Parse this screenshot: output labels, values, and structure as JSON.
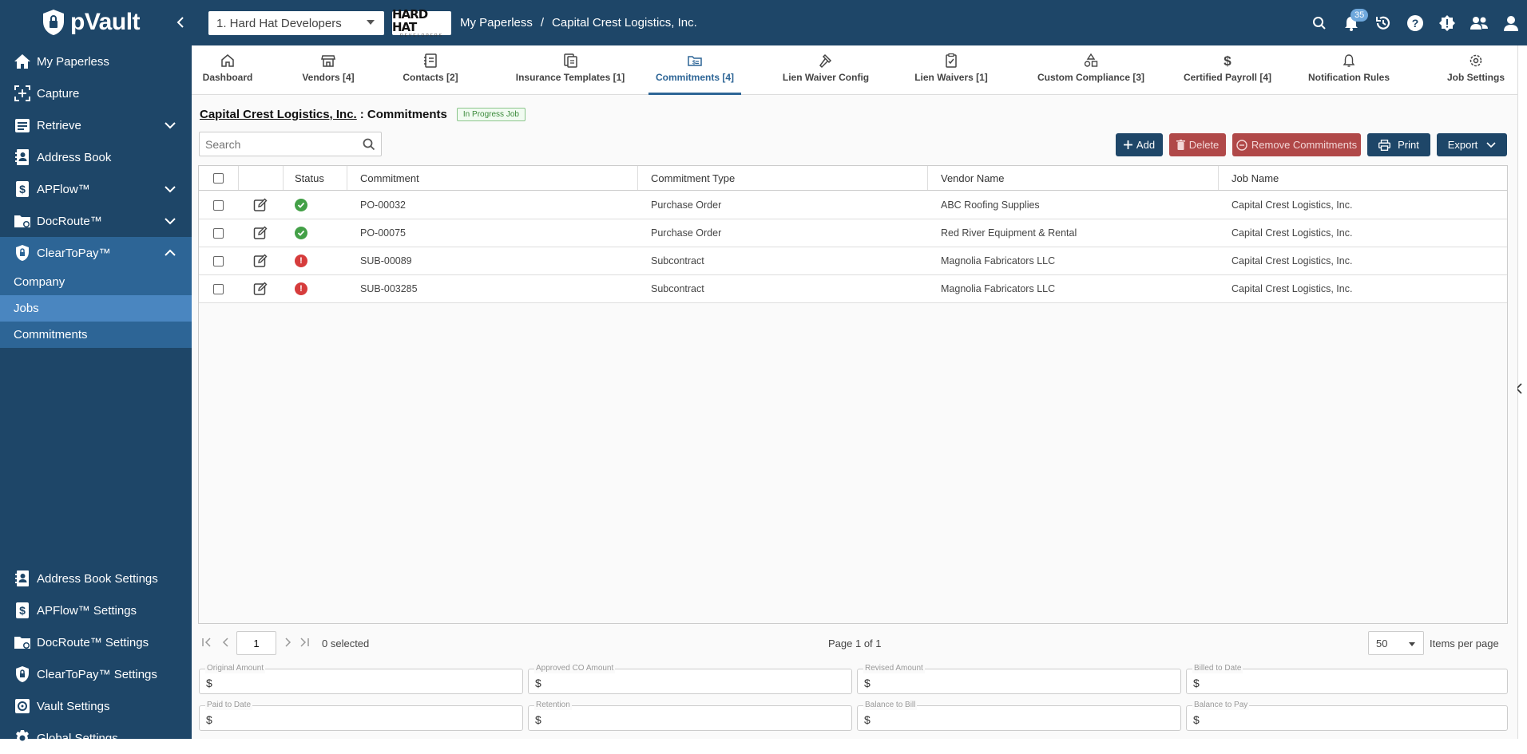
{
  "app": {
    "logo_text": "pVault",
    "company_select": "1. Hard Hat Developers",
    "company_logo_text": "HARD HAT",
    "company_logo_sub": "DEVELOPERS",
    "breadcrumb": [
      "My Paperless",
      "/",
      "Capital Crest Logistics, Inc."
    ],
    "notification_count": "35",
    "colors": {
      "primary": "#1e4668",
      "accent": "#2d6596",
      "danger": "#b04848",
      "success": "#43a047"
    }
  },
  "sidebar": {
    "items": [
      {
        "label": "My Paperless",
        "icon": "home-icon"
      },
      {
        "label": "Capture",
        "icon": "capture-icon"
      },
      {
        "label": "Retrieve",
        "icon": "retrieve-icon"
      },
      {
        "label": "Address Book",
        "icon": "address-book-icon"
      },
      {
        "label": "APFlow™",
        "icon": "dollar-doc-icon"
      },
      {
        "label": "DocRoute™",
        "icon": "folder-route-icon"
      },
      {
        "label": "ClearToPay™",
        "icon": "shield-icon"
      }
    ],
    "sub_items": [
      "Company",
      "Jobs",
      "Commitments"
    ],
    "settings": [
      {
        "label": "Address Book Settings",
        "icon": "address-book-icon"
      },
      {
        "label": "APFlow™ Settings",
        "icon": "dollar-doc-icon"
      },
      {
        "label": "DocRoute™ Settings",
        "icon": "folder-route-icon"
      },
      {
        "label": "ClearToPay™ Settings",
        "icon": "shield-icon"
      },
      {
        "label": "Vault Settings",
        "icon": "gear-icon"
      },
      {
        "label": "Global Settings",
        "icon": "gear-icon"
      }
    ]
  },
  "tabs": [
    {
      "label": "Dashboard",
      "icon": "home-icon"
    },
    {
      "label": "Vendors [4]",
      "icon": "store-icon"
    },
    {
      "label": "Contacts [2]",
      "icon": "contacts-icon"
    },
    {
      "label": "Insurance Templates [1]",
      "icon": "documents-icon"
    },
    {
      "label": "Commitments [4]",
      "icon": "commitments-icon"
    },
    {
      "label": "Lien Waiver Config",
      "icon": "hammer-icon"
    },
    {
      "label": "Lien Waivers [1]",
      "icon": "clipboard-check-icon"
    },
    {
      "label": "Custom Compliance [3]",
      "icon": "shapes-icon"
    },
    {
      "label": "Certified Payroll [4]",
      "icon": "dollar-icon"
    },
    {
      "label": "Notification Rules",
      "icon": "bell-icon"
    },
    {
      "label": "Job Settings",
      "icon": "gear-icon"
    }
  ],
  "page": {
    "title_link": "Capital Crest Logistics, Inc.",
    "title_suffix": ": Commitments",
    "status_chip": "In Progress Job",
    "search_placeholder": "Search"
  },
  "toolbar": {
    "add": "Add",
    "delete": "Delete",
    "remove": "Remove Commitments",
    "print": "Print",
    "export": "Export"
  },
  "table": {
    "headers": [
      "Status",
      "Commitment",
      "Commitment Type",
      "Vendor Name",
      "Job Name"
    ],
    "rows": [
      {
        "status": "ok",
        "commitment": "PO-00032",
        "type": "Purchase Order",
        "vendor": "ABC Roofing Supplies",
        "job": "Capital Crest Logistics, Inc."
      },
      {
        "status": "ok",
        "commitment": "PO-00075",
        "type": "Purchase Order",
        "vendor": "Red River Equipment & Rental",
        "job": "Capital Crest Logistics, Inc."
      },
      {
        "status": "error",
        "commitment": "SUB-00089",
        "type": "Subcontract",
        "vendor": "Magnolia Fabricators LLC",
        "job": "Capital Crest Logistics, Inc."
      },
      {
        "status": "error",
        "commitment": "SUB-003285",
        "type": "Subcontract",
        "vendor": "Magnolia Fabricators LLC",
        "job": "Capital Crest Logistics, Inc."
      }
    ]
  },
  "pager": {
    "page_input": "1",
    "selected_text": "0 selected",
    "page_info": "Page 1 of 1",
    "per_page": "50",
    "per_page_label": "Items per page"
  },
  "totals": [
    {
      "label": "Original Amount",
      "value": "$"
    },
    {
      "label": "Approved CO Amount",
      "value": "$"
    },
    {
      "label": "Revised Amount",
      "value": "$"
    },
    {
      "label": "Billed to Date",
      "value": "$"
    },
    {
      "label": "Paid to Date",
      "value": "$"
    },
    {
      "label": "Retention",
      "value": "$"
    },
    {
      "label": "Balance to Bill",
      "value": "$"
    },
    {
      "label": "Balance to Pay",
      "value": "$"
    }
  ]
}
